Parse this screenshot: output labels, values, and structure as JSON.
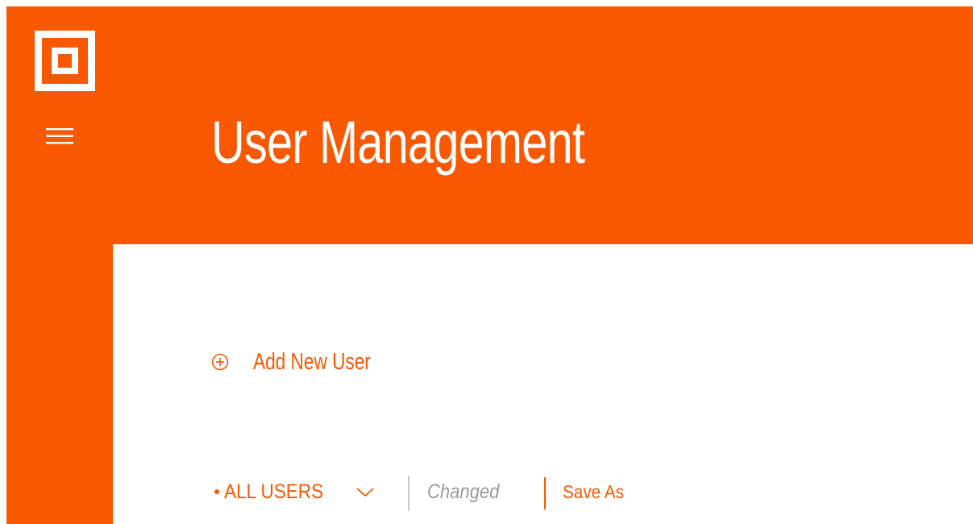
{
  "header": {
    "title": "User Management"
  },
  "sidebar": {
    "logo": "logo-square-icon",
    "menu_icon": "hamburger-menu-icon"
  },
  "main": {
    "add_user": {
      "icon": "plus-circle-icon",
      "label": "Add New User"
    },
    "filter_bar": {
      "view_selector": {
        "label": "ALL USERS",
        "icon": "chevron-down-icon"
      },
      "status_text": "Changed",
      "save_as_label": "Save As"
    }
  },
  "colors": {
    "brand_orange": "#f75800",
    "muted_gray": "#9a9a9a",
    "divider_gray": "#c8c8c8",
    "background": "#ffffff"
  }
}
